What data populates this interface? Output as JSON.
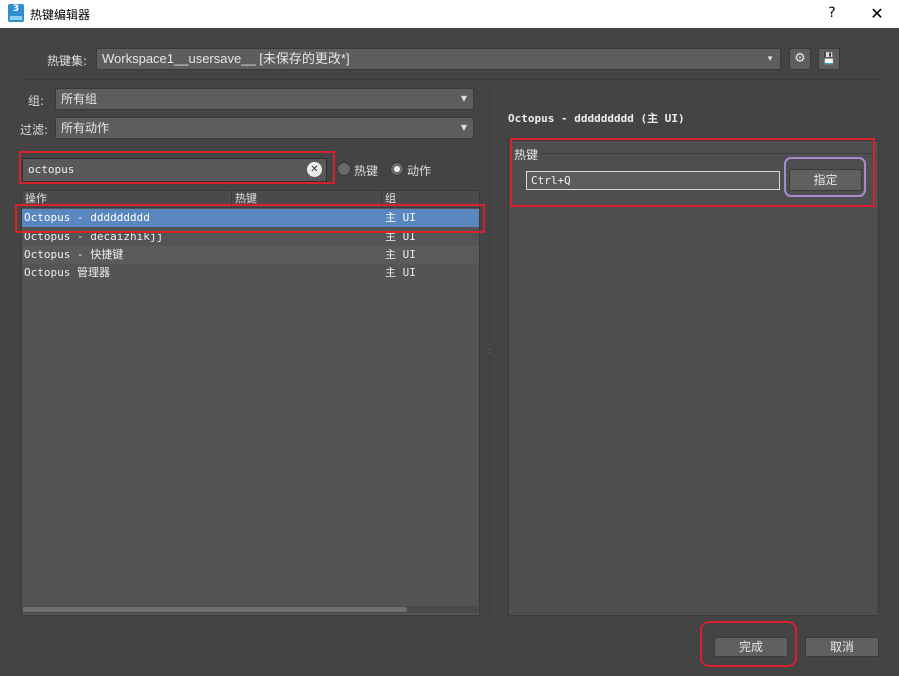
{
  "window": {
    "app_icon_label": "3",
    "title": "热键编辑器",
    "help_label": "?",
    "close_label": "✕"
  },
  "hotkey_set": {
    "label": "热键集:",
    "value": "Workspace1__usersave__ [未保存的更改*]",
    "settings_icon": "⚙",
    "save_icon": "💾"
  },
  "group": {
    "label": "组:",
    "value": "所有组"
  },
  "filter": {
    "label": "过滤:",
    "value": "所有动作"
  },
  "search": {
    "value": "octopus",
    "clear_icon": "✕",
    "mode_options": [
      {
        "label": "热键",
        "selected": false
      },
      {
        "label": "动作",
        "selected": true
      }
    ]
  },
  "table": {
    "columns": [
      "操作",
      "热键",
      "组"
    ],
    "rows": [
      {
        "action": "Octopus - ddddddddd",
        "hotkey": "",
        "group": "主 UI",
        "selected": true
      },
      {
        "action": "Octopus - decaizhikjj",
        "hotkey": "",
        "group": "主 UI",
        "selected": false
      },
      {
        "action": "Octopus - 快捷键",
        "hotkey": "",
        "group": "主 UI",
        "selected": false
      },
      {
        "action": "Octopus 管理器",
        "hotkey": "",
        "group": "主 UI",
        "selected": false
      }
    ]
  },
  "detail": {
    "action_title": "Octopus - ddddddddd (主 UI)",
    "hotkey_group_label": "热键",
    "hotkey_value": "Ctrl+Q",
    "assign_label": "指定"
  },
  "footer": {
    "done_label": "完成",
    "cancel_label": "取消"
  },
  "colors": {
    "background": "#444444",
    "selection": "#5b87c0",
    "annotation_red": "#d9212c",
    "annotation_purple": "#a58ad0"
  }
}
